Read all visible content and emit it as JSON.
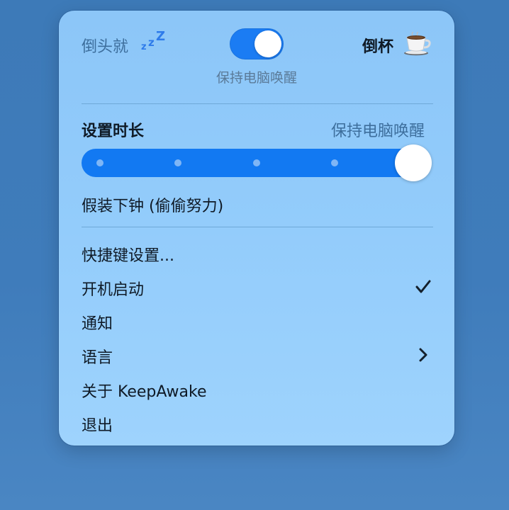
{
  "header": {
    "mode_left_label": "倒头就",
    "zzz_letters": [
      "z",
      "z",
      "Z"
    ],
    "toggle_on": true,
    "toggle_label": "保持电脑唤醒",
    "mode_right_label": "倒杯",
    "coffee_icon": "coffee-cup-icon"
  },
  "duration": {
    "title": "设置时长",
    "value": "保持电脑唤醒",
    "slider_level": 1.0,
    "accent_color": "#1279f2"
  },
  "fake_sleep_label": "假装下钟 (偷偷努力)",
  "menu": {
    "shortcuts": "快捷键设置...",
    "launch_at_login": "开机启动",
    "launch_checked": true,
    "notifications": "通知",
    "language": "语言",
    "about": "关于 KeepAwake",
    "quit": "退出"
  }
}
